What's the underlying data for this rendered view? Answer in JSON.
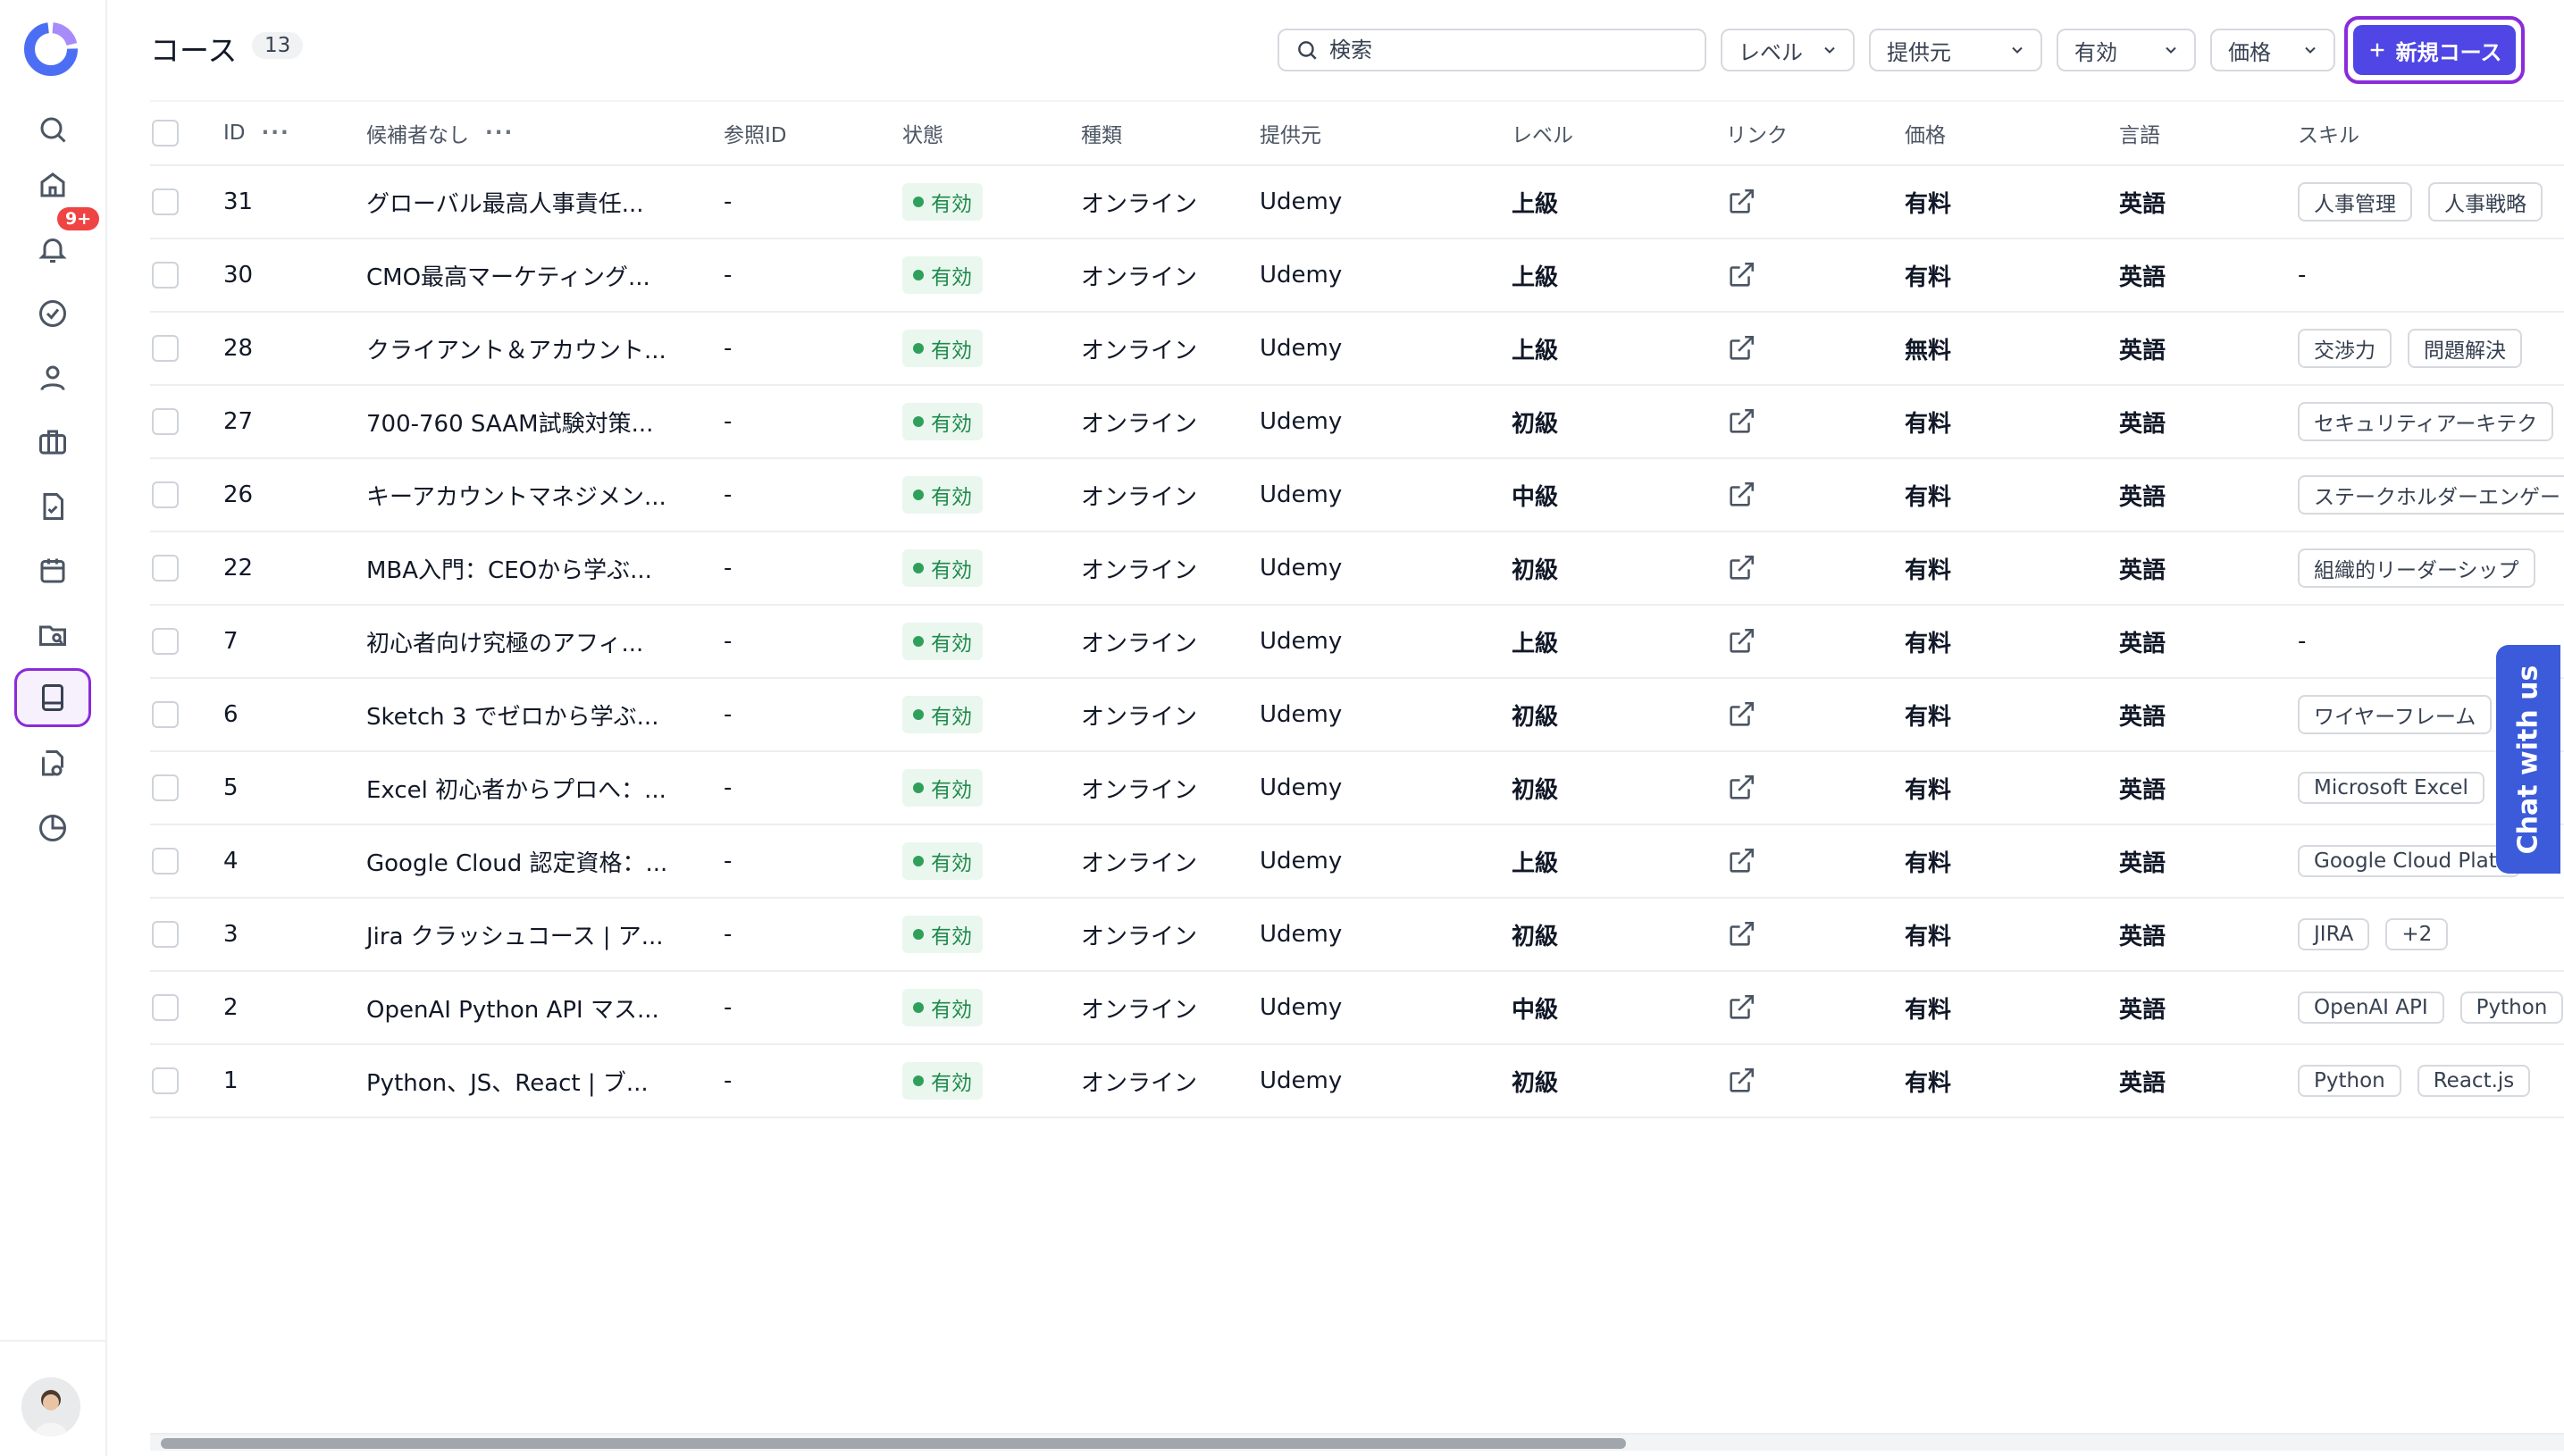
{
  "header": {
    "title": "コース",
    "count": "13",
    "search_placeholder": "検索",
    "filters": [
      {
        "label": "レベル"
      },
      {
        "label": "提供元"
      },
      {
        "label": "有効"
      },
      {
        "label": "価格"
      }
    ],
    "new_button": "新規コース"
  },
  "sidebar": {
    "notification_badge": "9+"
  },
  "table": {
    "columns": [
      "ID",
      "候補者なし",
      "参照ID",
      "状態",
      "種類",
      "提供元",
      "レベル",
      "リンク",
      "価格",
      "言語",
      "スキル"
    ],
    "rows": [
      {
        "id": "31",
        "name": "グローバル最高人事責任...",
        "ref": "-",
        "status": "有効",
        "type": "オンライン",
        "provider": "Udemy",
        "level": "上級",
        "price": "有料",
        "lang": "英語",
        "skills": [
          "人事管理",
          "人事戦略"
        ]
      },
      {
        "id": "30",
        "name": "CMO最高マーケティング...",
        "ref": "-",
        "status": "有効",
        "type": "オンライン",
        "provider": "Udemy",
        "level": "上級",
        "price": "有料",
        "lang": "英語",
        "skills": [
          "-"
        ]
      },
      {
        "id": "28",
        "name": "クライアント＆アカウント...",
        "ref": "-",
        "status": "有効",
        "type": "オンライン",
        "provider": "Udemy",
        "level": "上級",
        "price": "無料",
        "lang": "英語",
        "skills": [
          "交渉力",
          "問題解決"
        ]
      },
      {
        "id": "27",
        "name": "700-760 SAAM試験対策...",
        "ref": "-",
        "status": "有効",
        "type": "オンライン",
        "provider": "Udemy",
        "level": "初級",
        "price": "有料",
        "lang": "英語",
        "skills": [
          "セキュリティアーキテク"
        ]
      },
      {
        "id": "26",
        "name": "キーアカウントマネジメン...",
        "ref": "-",
        "status": "有効",
        "type": "オンライン",
        "provider": "Udemy",
        "level": "中級",
        "price": "有料",
        "lang": "英語",
        "skills": [
          "ステークホルダーエンゲー"
        ]
      },
      {
        "id": "22",
        "name": "MBA入門：CEOから学ぶ...",
        "ref": "-",
        "status": "有効",
        "type": "オンライン",
        "provider": "Udemy",
        "level": "初級",
        "price": "有料",
        "lang": "英語",
        "skills": [
          "組織的リーダーシップ"
        ]
      },
      {
        "id": "7",
        "name": "初心者向け究極のアフィ...",
        "ref": "-",
        "status": "有効",
        "type": "オンライン",
        "provider": "Udemy",
        "level": "上級",
        "price": "有料",
        "lang": "英語",
        "skills": [
          "-"
        ]
      },
      {
        "id": "6",
        "name": "Sketch 3 でゼロから学ぶ...",
        "ref": "-",
        "status": "有効",
        "type": "オンライン",
        "provider": "Udemy",
        "level": "初級",
        "price": "有料",
        "lang": "英語",
        "skills": [
          "ワイヤーフレーム"
        ]
      },
      {
        "id": "5",
        "name": "Excel 初心者からプロへ：...",
        "ref": "-",
        "status": "有効",
        "type": "オンライン",
        "provider": "Udemy",
        "level": "初級",
        "price": "有料",
        "lang": "英語",
        "skills": [
          "Microsoft Excel"
        ]
      },
      {
        "id": "4",
        "name": "Google Cloud 認定資格：...",
        "ref": "-",
        "status": "有効",
        "type": "オンライン",
        "provider": "Udemy",
        "level": "上級",
        "price": "有料",
        "lang": "英語",
        "skills": [
          "Google Cloud Platf"
        ]
      },
      {
        "id": "3",
        "name": "Jira クラッシュコース | ア...",
        "ref": "-",
        "status": "有効",
        "type": "オンライン",
        "provider": "Udemy",
        "level": "初級",
        "price": "有料",
        "lang": "英語",
        "skills": [
          "JIRA",
          "+2"
        ]
      },
      {
        "id": "2",
        "name": "OpenAI Python API マス...",
        "ref": "-",
        "status": "有効",
        "type": "オンライン",
        "provider": "Udemy",
        "level": "中級",
        "price": "有料",
        "lang": "英語",
        "skills": [
          "OpenAI API",
          "Python"
        ]
      },
      {
        "id": "1",
        "name": "Python、JS、React | ブ...",
        "ref": "-",
        "status": "有効",
        "type": "オンライン",
        "provider": "Udemy",
        "level": "初級",
        "price": "有料",
        "lang": "英語",
        "skills": [
          "Python",
          "React.js"
        ]
      }
    ]
  },
  "chat_button": "Chat with us",
  "colors": {
    "accent": "#4f46e5",
    "active_ring": "#8b2bd9",
    "status_bg": "#eaf7ee",
    "status_text": "#1f8a4c",
    "badge": "#ef4444",
    "chat": "#3b5bdb"
  }
}
